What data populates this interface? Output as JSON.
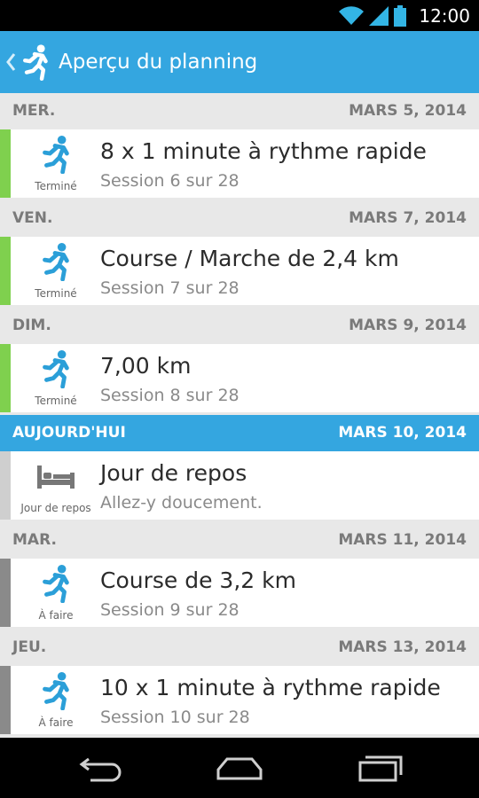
{
  "status_bar": {
    "time": "12:00",
    "icons": [
      "wifi-icon",
      "signal-icon",
      "battery-icon"
    ]
  },
  "action_bar": {
    "title": "Aperçu du planning",
    "icon": "runner-icon"
  },
  "colors": {
    "accent": "#34a6e0",
    "done": "#7fd04e",
    "rest": "#cfcfcf",
    "todo": "#8a8a8a"
  },
  "days": [
    {
      "day": "MER.",
      "date": "MARS 5, 2014",
      "title": "8 x 1 minute à rythme rapide",
      "subtitle": "Session 6 sur 28",
      "status": "Terminé"
    },
    {
      "day": "VEN.",
      "date": "MARS 7, 2014",
      "title": "Course / Marche de 2,4 km",
      "subtitle": "Session 7 sur 28",
      "status": "Terminé"
    },
    {
      "day": "DIM.",
      "date": "MARS 9, 2014",
      "title": "7,00 km",
      "subtitle": "Session 8 sur 28",
      "status": "Terminé"
    },
    {
      "day": "AUJOURD'HUI",
      "date": "MARS 10, 2014",
      "title": "Jour de repos",
      "subtitle": "Allez-y doucement.",
      "status": "Jour de repos"
    },
    {
      "day": "MAR.",
      "date": "MARS 11, 2014",
      "title": "Course de 3,2 km",
      "subtitle": "Session 9 sur 28",
      "status": "À faire"
    },
    {
      "day": "JEU.",
      "date": "MARS 13, 2014",
      "title": "10 x 1 minute à rythme rapide",
      "subtitle": "Session 10 sur 28",
      "status": "À faire"
    }
  ],
  "nav_bar": {
    "buttons": [
      "back-icon",
      "home-icon",
      "recent-apps-icon"
    ]
  }
}
